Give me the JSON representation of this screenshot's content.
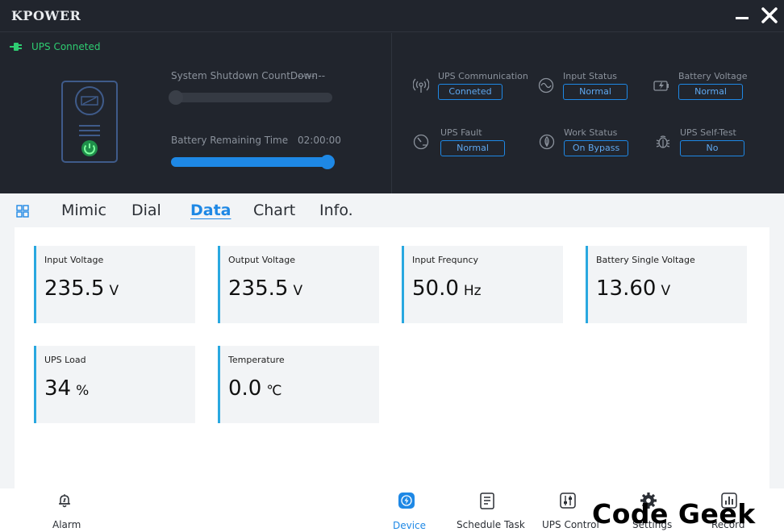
{
  "app": {
    "brand": "KPOWER"
  },
  "connection": {
    "status": "UPS Conneted"
  },
  "shutdown": {
    "label": "System Shutdown CountDown",
    "value": "--:--:--",
    "progress": 0
  },
  "battery_time": {
    "label": "Battery Remaining Time",
    "value": "02:00:00",
    "progress": 1.0
  },
  "status": {
    "ups_communication": {
      "label": "UPS Communication",
      "value": "Conneted",
      "icon": "signal-icon"
    },
    "input_status": {
      "label": "Input Status",
      "value": "Normal",
      "icon": "sine-wave-icon"
    },
    "battery_voltage": {
      "label": "Battery Voltage",
      "value": "Normal",
      "icon": "battery-charging-icon"
    },
    "ups_fault": {
      "label": "UPS Fault",
      "value": "Normal",
      "icon": "gauge-icon"
    },
    "work_status": {
      "label": "Work Status",
      "value": "On Bypass",
      "icon": "leaf-icon"
    },
    "ups_self_test": {
      "label": "UPS Self-Test",
      "value": "No",
      "icon": "bug-icon"
    }
  },
  "tabs": [
    {
      "label": "Mimic"
    },
    {
      "label": "Dial"
    },
    {
      "label": "Data",
      "active": true
    },
    {
      "label": "Chart"
    },
    {
      "label": "Info."
    }
  ],
  "cards": [
    {
      "title": "Input Voltage",
      "value": "235.5",
      "unit": "V"
    },
    {
      "title": "Output Voltage",
      "value": "235.5",
      "unit": "V"
    },
    {
      "title": "Input Frequncy",
      "value": "50.0",
      "unit": "Hz"
    },
    {
      "title": "Battery Single Voltage",
      "value": "13.60",
      "unit": "V"
    },
    {
      "title": "UPS Load",
      "value": "34",
      "unit": "%"
    },
    {
      "title": "Temperature",
      "value": "0.0",
      "unit": "℃"
    }
  ],
  "bottom_nav": [
    {
      "label": "Alarm",
      "icon": "bell-icon"
    },
    {
      "label": "Device",
      "icon": "lightning-icon",
      "active": true
    },
    {
      "label": "Schedule Task",
      "icon": "document-icon"
    },
    {
      "label": "UPS Control",
      "icon": "sliders-icon"
    },
    {
      "label": "Settings",
      "icon": "gear-icon"
    },
    {
      "label": "Record",
      "icon": "bar-chart-icon"
    }
  ],
  "watermark": "Code Geek",
  "colors": {
    "accent": "#1e88e5",
    "connected": "#2ecc71",
    "dark_bg": "#21252d",
    "card_border": "#29a8e0"
  }
}
